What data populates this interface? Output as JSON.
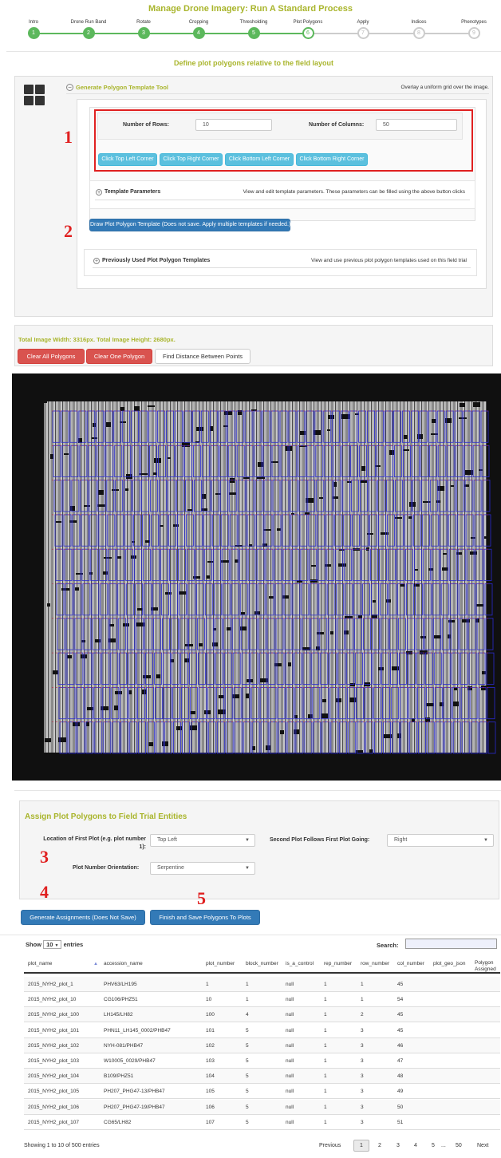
{
  "page_title": "Manage Drone Imagery: Run A Standard Process",
  "wizard": {
    "steps": [
      {
        "label": "Intro",
        "num": "1",
        "state": "done"
      },
      {
        "label": "Drone Run Band",
        "num": "2",
        "state": "done"
      },
      {
        "label": "Rotate",
        "num": "3",
        "state": "done"
      },
      {
        "label": "Cropping",
        "num": "4",
        "state": "done"
      },
      {
        "label": "Thresholding",
        "num": "5",
        "state": "done"
      },
      {
        "label": "Plot Polygons",
        "num": "6",
        "state": "current"
      },
      {
        "label": "Apply",
        "num": "7",
        "state": "todo"
      },
      {
        "label": "Indices",
        "num": "8",
        "state": "todo"
      },
      {
        "label": "Phenotypes",
        "num": "9",
        "state": "todo"
      }
    ]
  },
  "polygons": {
    "heading": "Define plot polygons relative to the field layout",
    "template_tool": {
      "title": "Generate Polygon Template Tool",
      "description": "Overlay a uniform grid over the image.",
      "rows_label": "Number of Rows:",
      "rows_value": "10",
      "cols_label": "Number of Columns:",
      "cols_value": "50",
      "corner_buttons": [
        "Click Top Left Corner",
        "Click Top Right Corner",
        "Click Bottom Left Corner",
        "Click Bottom Right Corner"
      ],
      "params_title": "Template Parameters",
      "params_desc": "View and edit template parameters. These parameters can be filled using the above button clicks",
      "draw_button": "Draw Plot Polygon Template (Does not save. Apply multiple templates if needed.)",
      "prev_title": "Previously Used Plot Polygon Templates",
      "prev_desc": "View and use previous plot polygon templates used on this field trial"
    },
    "markers": [
      "1",
      "2",
      "3",
      "4",
      "5"
    ],
    "image_size": "Total Image Width: 3316px. Total Image Height: 2680px.",
    "clear_all": "Clear All Polygons",
    "clear_one": "Clear One Polygon",
    "find_distance": "Find Distance Between Points",
    "grid_rows": 10,
    "grid_cols": 50
  },
  "assign": {
    "heading": "Assign Plot Polygons to Field Trial Entities",
    "first_plot_label_1": "Location of First Plot (e.g. plot number",
    "first_plot_label_2": "1):",
    "first_plot_value": "Top Left",
    "follow_label": "Second Plot Follows First Plot Going:",
    "follow_value": "Right",
    "orientation_label": "Plot Number Orientation:",
    "orientation_value": "Serpentine",
    "generate_button": "Generate Assignments (Does Not Save)",
    "finish_button": "Finish and Save Polygons To Plots"
  },
  "table": {
    "show_label": "Show",
    "show_value": "10",
    "entries_label": "entries",
    "search_label": "Search:",
    "columns": [
      "plot_name",
      "accession_name",
      "plot_number",
      "block_number",
      "is_a_control",
      "rep_number",
      "row_number",
      "col_number",
      "plot_geo_json",
      "Polygon",
      "Assigned"
    ],
    "rows": [
      [
        "2015_NYH2_plot_1",
        "PHV63/LH195",
        "1",
        "1",
        "null",
        "1",
        "1",
        "45"
      ],
      [
        "2015_NYH2_plot_10",
        "CG106/PHZ51",
        "10",
        "1",
        "null",
        "1",
        "1",
        "54"
      ],
      [
        "2015_NYH2_plot_100",
        "LH145/LH82",
        "100",
        "4",
        "null",
        "1",
        "2",
        "45"
      ],
      [
        "2015_NYH2_plot_101",
        "PHN11_LH145_0002/PHB47",
        "101",
        "5",
        "null",
        "1",
        "3",
        "45"
      ],
      [
        "2015_NYH2_plot_102",
        "NYH-081/PHB47",
        "102",
        "5",
        "null",
        "1",
        "3",
        "46"
      ],
      [
        "2015_NYH2_plot_103",
        "W10005_0029/PHB47",
        "103",
        "5",
        "null",
        "1",
        "3",
        "47"
      ],
      [
        "2015_NYH2_plot_104",
        "B109/PHZ51",
        "104",
        "5",
        "null",
        "1",
        "3",
        "48"
      ],
      [
        "2015_NYH2_plot_105",
        "PH207_PHG47-13/PHB47",
        "105",
        "5",
        "null",
        "1",
        "3",
        "49"
      ],
      [
        "2015_NYH2_plot_106",
        "PH207_PHG47-19/PHB47",
        "106",
        "5",
        "null",
        "1",
        "3",
        "50"
      ],
      [
        "2015_NYH2_plot_107",
        "CG65/LH82",
        "107",
        "5",
        "null",
        "1",
        "3",
        "51"
      ]
    ],
    "info": "Showing 1 to 10 of 500 entries",
    "pagination": {
      "previous": "Previous",
      "pages": [
        "1",
        "2",
        "3",
        "4",
        "5",
        "...",
        "50"
      ],
      "next": "Next"
    }
  },
  "colors": {
    "olive": "#a9b52c",
    "green": "#5cb85c",
    "info": "#5bc0de",
    "primary": "#337ab7",
    "danger": "#d9534f",
    "marker_red": "#e02020",
    "polygon_blue": "#2b2bd0"
  }
}
